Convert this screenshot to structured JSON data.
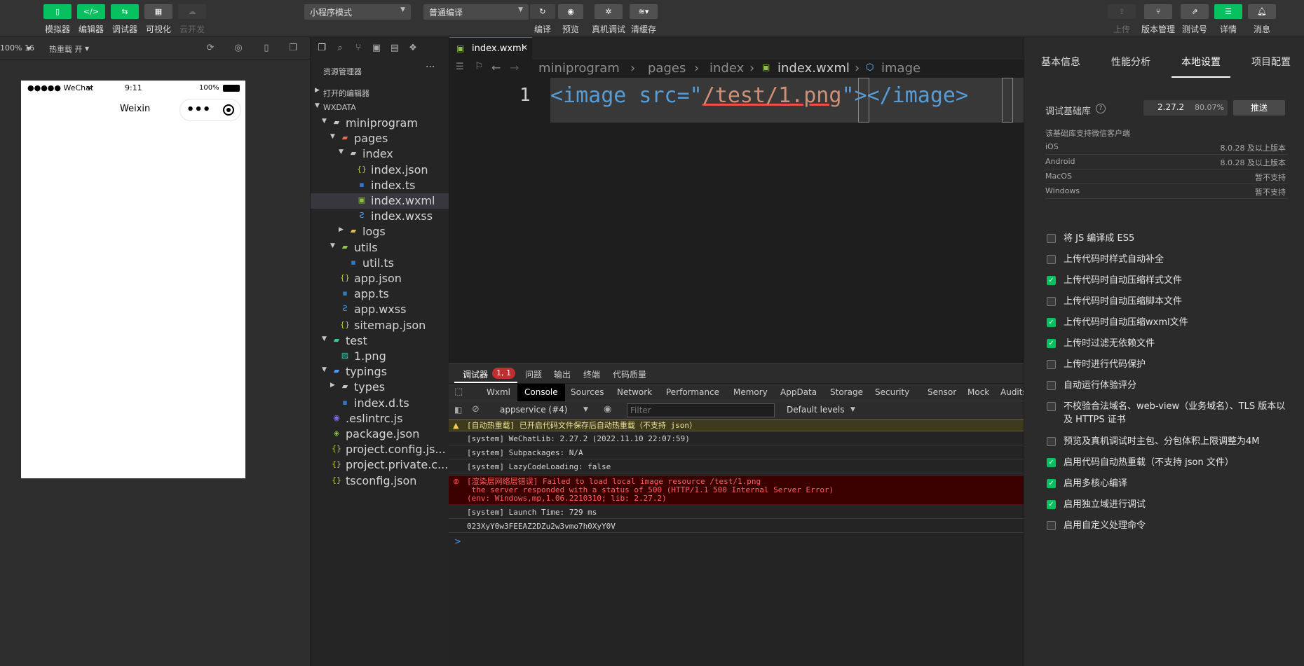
{
  "toolbar": {
    "left_buttons": [
      {
        "label": "模拟器",
        "icon": "phone-icon",
        "state": "green"
      },
      {
        "label": "编辑器",
        "icon": "code-icon",
        "state": "green"
      },
      {
        "label": "调试器",
        "icon": "debug-arrows-icon",
        "state": "green"
      },
      {
        "label": "可视化",
        "icon": "layout-icon",
        "state": "gray"
      },
      {
        "label": "云开发",
        "icon": "cloud-icon",
        "state": "disabled"
      }
    ],
    "mode_select": "小程序模式",
    "compile_select": "普通编译",
    "center_buttons": [
      {
        "label": "编译",
        "icon": "refresh-icon"
      },
      {
        "label": "预览",
        "icon": "eye-icon"
      },
      {
        "label": "真机调试",
        "icon": "bug-icon"
      },
      {
        "label": "清缓存",
        "icon": "layers-icon"
      }
    ],
    "right_buttons": [
      {
        "label": "上传",
        "icon": "upload-icon",
        "state": "disabled"
      },
      {
        "label": "版本管理",
        "icon": "branch-icon",
        "state": "gray"
      },
      {
        "label": "测试号",
        "icon": "external-icon",
        "state": "gray"
      },
      {
        "label": "详情",
        "icon": "menu-icon",
        "state": "green"
      },
      {
        "label": "消息",
        "icon": "bell-icon",
        "state": "gray"
      }
    ]
  },
  "simulator": {
    "zoom": "100% 16",
    "hot_reload": "热重载 开",
    "status_carrier": "●●●●● WeChat",
    "status_time": "9:11",
    "status_battery": "100%",
    "nav_title": "Weixin",
    "capsule_dots": "•••"
  },
  "explorer": {
    "title": "资源管理器",
    "more": "···",
    "open_editors": "打开的编辑器",
    "workspace": "WXDATA",
    "tree": [
      {
        "label": "miniprogram",
        "depth": 1,
        "kind": "folder",
        "open": true
      },
      {
        "label": "pages",
        "depth": 2,
        "kind": "folder-red",
        "open": true
      },
      {
        "label": "index",
        "depth": 3,
        "kind": "folder",
        "open": true
      },
      {
        "label": "index.json",
        "depth": 4,
        "kind": "json"
      },
      {
        "label": "index.ts",
        "depth": 4,
        "kind": "ts"
      },
      {
        "label": "index.wxml",
        "depth": 4,
        "kind": "wxml",
        "selected": true
      },
      {
        "label": "index.wxss",
        "depth": 4,
        "kind": "wxss"
      },
      {
        "label": "logs",
        "depth": 3,
        "kind": "folder-yellow",
        "open": false
      },
      {
        "label": "utils",
        "depth": 2,
        "kind": "folder-green",
        "open": true
      },
      {
        "label": "util.ts",
        "depth": 3,
        "kind": "ts"
      },
      {
        "label": "app.json",
        "depth": 2,
        "kind": "json"
      },
      {
        "label": "app.ts",
        "depth": 2,
        "kind": "ts"
      },
      {
        "label": "app.wxss",
        "depth": 2,
        "kind": "wxss"
      },
      {
        "label": "sitemap.json",
        "depth": 2,
        "kind": "json"
      },
      {
        "label": "test",
        "depth": 1,
        "kind": "folder-teal",
        "open": true
      },
      {
        "label": "1.png",
        "depth": 2,
        "kind": "image"
      },
      {
        "label": "typings",
        "depth": 1,
        "kind": "folder-blue",
        "open": true
      },
      {
        "label": "types",
        "depth": 2,
        "kind": "folder",
        "open": false
      },
      {
        "label": "index.d.ts",
        "depth": 2,
        "kind": "ts"
      },
      {
        "label": ".eslintrc.js",
        "depth": 1,
        "kind": "eslint"
      },
      {
        "label": "package.json",
        "depth": 1,
        "kind": "npm"
      },
      {
        "label": "project.config.js...",
        "depth": 1,
        "kind": "json"
      },
      {
        "label": "project.private.c...",
        "depth": 1,
        "kind": "json"
      },
      {
        "label": "tsconfig.json",
        "depth": 1,
        "kind": "json"
      }
    ]
  },
  "editor": {
    "tab_label": "index.wxml",
    "tab_close": "✕",
    "breadcrumb": [
      "miniprogram",
      "pages",
      "index",
      "index.wxml",
      "image"
    ],
    "line_number": "1",
    "code_open": "<image src=\"",
    "code_string": "/test/1.png",
    "code_mid": "\">",
    "code_close": "</image>"
  },
  "devtools": {
    "top_tabs": [
      {
        "label": "调试器",
        "badge": "1, 1"
      },
      {
        "label": "问题"
      },
      {
        "label": "输出"
      },
      {
        "label": "终端"
      },
      {
        "label": "代码质量"
      }
    ],
    "panel_tabs": [
      "Wxml",
      "Console",
      "Sources",
      "Network",
      "Performance",
      "Memory",
      "AppData",
      "Storage",
      "Security",
      "Sensor",
      "Mock",
      "Audits"
    ],
    "active_panel": "Console",
    "context": "appservice (#4)",
    "filter_placeholder": "Filter",
    "levels": "Default levels",
    "logs": [
      {
        "type": "warn",
        "text": "[自动热重载] 已开启代码文件保存后自动热重载（不支持 json）"
      },
      {
        "type": "info",
        "text": "[system] WeChatLib: 2.27.2 (2022.11.10 22:07:59)"
      },
      {
        "type": "info",
        "text": "[system] Subpackages: N/A"
      },
      {
        "type": "info",
        "text": "[system] LazyCodeLoading: false"
      },
      {
        "type": "error",
        "text": "[渲染层网络层错误] Failed to load local image resource /test/1.png\n the server responded with a status of 500 (HTTP/1.1 500 Internal Server Error)\n(env: Windows,mp,1.06.2210310; lib: 2.27.2)"
      },
      {
        "type": "info",
        "text": "[system] Launch Time: 729 ms"
      },
      {
        "type": "info",
        "text": "023XyY0w3FEEAZ2DZu2w3vmo7h0XyY0V"
      }
    ],
    "prompt": ">"
  },
  "settings": {
    "tabs": [
      "基本信息",
      "性能分析",
      "本地设置",
      "项目配置"
    ],
    "active_tab": "本地设置",
    "lib_label": "调试基础库",
    "lib_version": "2.27.2",
    "lib_percent": "80.07%",
    "push_label": "推送",
    "support_title": "该基础库支持微信客户端",
    "platforms": [
      {
        "name": "iOS",
        "value": "8.0.28 及以上版本"
      },
      {
        "name": "Android",
        "value": "8.0.28 及以上版本"
      },
      {
        "name": "MacOS",
        "value": "暂不支持"
      },
      {
        "name": "Windows",
        "value": "暂不支持"
      }
    ],
    "options": [
      {
        "label": "将 JS 编译成 ES5",
        "checked": false
      },
      {
        "label": "上传代码时样式自动补全",
        "checked": false
      },
      {
        "label": "上传代码时自动压缩样式文件",
        "checked": true
      },
      {
        "label": "上传代码时自动压缩脚本文件",
        "checked": false
      },
      {
        "label": "上传代码时自动压缩wxml文件",
        "checked": true
      },
      {
        "label": "上传时过滤无依赖文件",
        "checked": true
      },
      {
        "label": "上传时进行代码保护",
        "checked": false
      },
      {
        "label": "自动运行体验评分",
        "checked": false
      },
      {
        "label": "不校验合法域名、web-view（业务域名）、TLS 版本以及 HTTPS 证书",
        "checked": false
      },
      {
        "label": "预览及真机调试时主包、分包体积上限调整为4M",
        "checked": false
      },
      {
        "label": "启用代码自动热重载（不支持 json 文件）",
        "checked": true
      },
      {
        "label": "启用多核心编译",
        "checked": true
      },
      {
        "label": "启用独立域进行调试",
        "checked": true
      },
      {
        "label": "启用自定义处理命令",
        "checked": false
      }
    ]
  }
}
